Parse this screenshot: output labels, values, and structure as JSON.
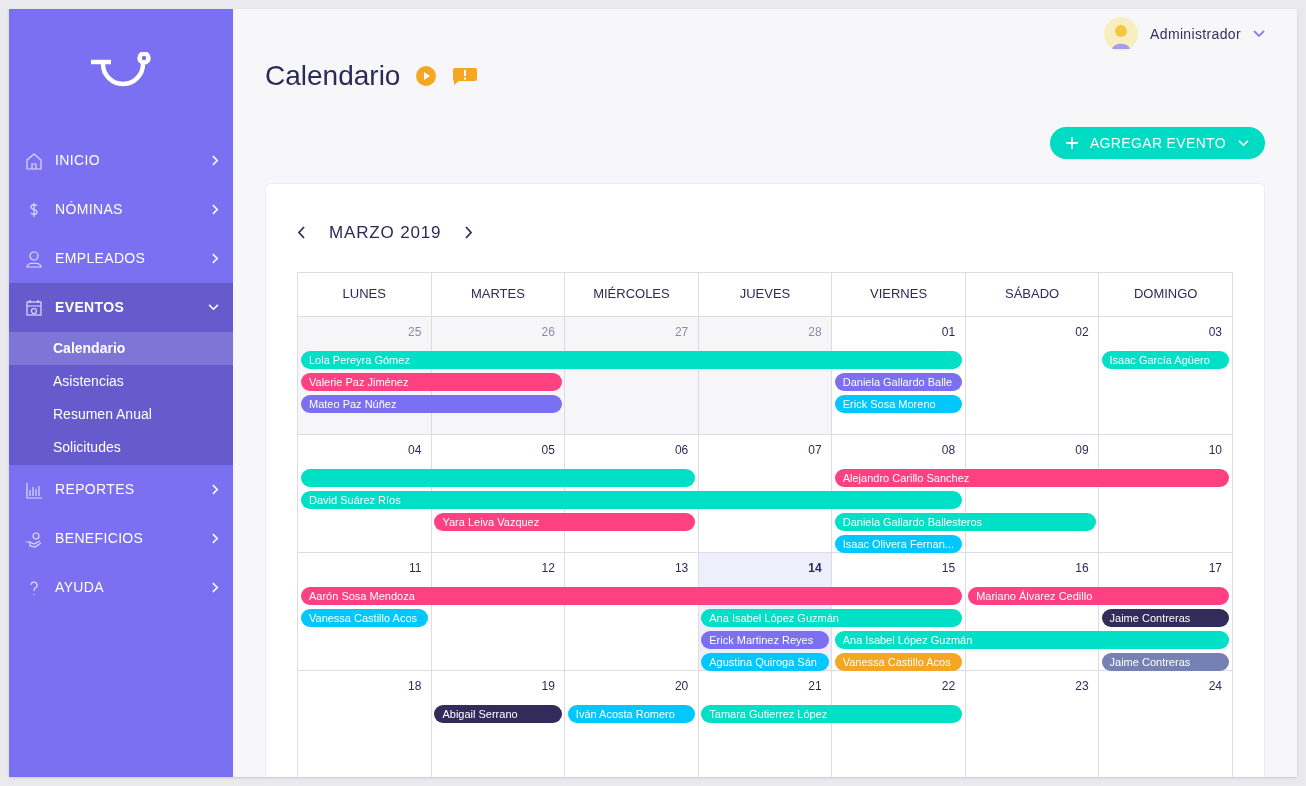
{
  "sidebar": {
    "items": [
      {
        "label": "INICIO",
        "expanded": false
      },
      {
        "label": "NÓMINAS",
        "expanded": false
      },
      {
        "label": "EMPLEADOS",
        "expanded": false
      },
      {
        "label": "EVENTOS",
        "expanded": true,
        "children": [
          {
            "label": "Calendario",
            "selected": true
          },
          {
            "label": "Asistencias",
            "selected": false
          },
          {
            "label": "Resumen Anual",
            "selected": false
          },
          {
            "label": "Solicitudes",
            "selected": false
          }
        ]
      },
      {
        "label": "REPORTES",
        "expanded": false
      },
      {
        "label": "BENEFICIOS",
        "expanded": false
      },
      {
        "label": "AYUDA",
        "expanded": false
      }
    ]
  },
  "user": {
    "name": "Administrador"
  },
  "page": {
    "title": "Calendario"
  },
  "add_button": {
    "label": "AGREGAR EVENTO"
  },
  "calendar": {
    "month": "MARZO 2019",
    "weekdays": [
      "LUNES",
      "MARTES",
      "MIÉRCOLES",
      "JUEVES",
      "VIERNES",
      "SÁBADO",
      "DOMINGO"
    ],
    "weeks": [
      {
        "days": [
          {
            "label": "25",
            "outside_month": true,
            "today": false
          },
          {
            "label": "26",
            "outside_month": true,
            "today": false
          },
          {
            "label": "27",
            "outside_month": true,
            "today": false
          },
          {
            "label": "28",
            "outside_month": true,
            "today": false
          },
          {
            "label": "01",
            "outside_month": false,
            "today": false
          },
          {
            "label": "02",
            "outside_month": false,
            "today": false
          },
          {
            "label": "03",
            "outside_month": false,
            "today": false
          }
        ],
        "lanes": [
          [
            {
              "kind": "event",
              "label": "Lola Pereyra Gómez",
              "color": "#00e0c6"
            },
            {
              "kind": "continuation"
            },
            {
              "kind": "continuation"
            },
            {
              "kind": "continuation"
            },
            {
              "kind": "continuation"
            },
            {
              "kind": "blank"
            },
            {
              "kind": "event",
              "label": "Isaac García Agüero",
              "color": "#00e0c6"
            }
          ],
          [
            {
              "kind": "event",
              "label": "Valerie Paz Jiménez",
              "color": "#ff4081"
            },
            {
              "kind": "continuation"
            },
            {
              "kind": "blank"
            },
            {
              "kind": "blank"
            },
            {
              "kind": "event",
              "label": "Daniela Gallardo Balle",
              "color": "#7b6ff2"
            }
          ],
          [
            {
              "kind": "event",
              "label": "Mateo Paz Núñez",
              "color": "#7b6ff2"
            },
            {
              "kind": "continuation"
            },
            {
              "kind": "blank"
            },
            {
              "kind": "blank"
            },
            {
              "kind": "event",
              "label": "Erick Sosa Moreno",
              "color": "#00c8ff"
            }
          ]
        ]
      },
      {
        "days": [
          {
            "label": "04",
            "outside_month": false,
            "today": false
          },
          {
            "label": "05",
            "outside_month": false,
            "today": false
          },
          {
            "label": "06",
            "outside_month": false,
            "today": false
          },
          {
            "label": "07",
            "outside_month": false,
            "today": false
          },
          {
            "label": "08",
            "outside_month": false,
            "today": false
          },
          {
            "label": "09",
            "outside_month": false,
            "today": false
          },
          {
            "label": "10",
            "outside_month": false,
            "today": false
          }
        ],
        "lanes": [
          [
            {
              "kind": "event",
              "color": "#00e0c6"
            },
            {
              "kind": "continuation"
            },
            {
              "kind": "continuation"
            },
            {
              "kind": "blank"
            },
            {
              "kind": "event",
              "label": "Alejandro Carillo Sanchez",
              "color": "#ff4081"
            },
            {
              "kind": "continuation"
            },
            {
              "kind": "continuation"
            }
          ],
          [
            {
              "kind": "event",
              "label": "David Suárez Ríos",
              "color": "#00e0c6"
            },
            {
              "kind": "continuation"
            },
            {
              "kind": "continuation"
            },
            {
              "kind": "continuation"
            },
            {
              "kind": "continuation"
            }
          ],
          [
            {
              "kind": "blank"
            },
            {
              "kind": "event",
              "label": "Yara Leiva Vazquez",
              "color": "#ff4081"
            },
            {
              "kind": "continuation"
            },
            {
              "kind": "blank"
            },
            {
              "kind": "event",
              "label": "Daniela Gallardo Ballesteros",
              "color": "#00e0c6"
            },
            {
              "kind": "continuation"
            }
          ],
          [
            {
              "kind": "blank"
            },
            {
              "kind": "blank"
            },
            {
              "kind": "blank"
            },
            {
              "kind": "blank"
            },
            {
              "kind": "event",
              "label": "Isaac Olivera Fernan...",
              "color": "#00c8ff"
            }
          ]
        ]
      },
      {
        "days": [
          {
            "label": "11",
            "outside_month": false,
            "today": false
          },
          {
            "label": "12",
            "outside_month": false,
            "today": false
          },
          {
            "label": "13",
            "outside_month": false,
            "today": false
          },
          {
            "label": "14",
            "outside_month": false,
            "today": true
          },
          {
            "label": "15",
            "outside_month": false,
            "today": false
          },
          {
            "label": "16",
            "outside_month": false,
            "today": false
          },
          {
            "label": "17",
            "outside_month": false,
            "today": false
          }
        ],
        "lanes": [
          [
            {
              "kind": "event",
              "label": "Aarón Sosa Mendoza",
              "color": "#ff4081"
            },
            {
              "kind": "continuation"
            },
            {
              "kind": "continuation"
            },
            {
              "kind": "continuation"
            },
            {
              "kind": "continuation"
            },
            {
              "kind": "event",
              "label": "Mariano Álvarez Cedillo",
              "color": "#ff4081"
            },
            {
              "kind": "continuation"
            }
          ],
          [
            {
              "kind": "event",
              "label": "Vanessa Castillo Acos",
              "color": "#00c8ff"
            },
            {
              "kind": "blank"
            },
            {
              "kind": "blank"
            },
            {
              "kind": "event",
              "label": "Ana Isabel López Guzmán",
              "color": "#00e0c6"
            },
            {
              "kind": "continuation"
            },
            {
              "kind": "blank"
            },
            {
              "kind": "event",
              "label": "Jaime Contreras",
              "color": "#322b5c"
            }
          ],
          [
            {
              "kind": "blank"
            },
            {
              "kind": "blank"
            },
            {
              "kind": "blank"
            },
            {
              "kind": "event",
              "label": "Erick Martinez Reyes",
              "color": "#7b6ff2"
            },
            {
              "kind": "event",
              "label": "Ana Isabel López Guzmán",
              "color": "#00e0c6"
            },
            {
              "kind": "continuation"
            },
            {
              "kind": "continuation"
            }
          ],
          [
            {
              "kind": "blank"
            },
            {
              "kind": "blank"
            },
            {
              "kind": "blank"
            },
            {
              "kind": "event",
              "label": "Agustina Quiroga Sán",
              "color": "#00c8ff"
            },
            {
              "kind": "event",
              "label": "Vanessa Castillo Acos",
              "color": "#f5a623"
            },
            {
              "kind": "blank"
            },
            {
              "kind": "event",
              "label": "Jaime Contreras",
              "color": "#7681b3"
            }
          ]
        ]
      },
      {
        "days": [
          {
            "label": "18",
            "outside_month": false,
            "today": false
          },
          {
            "label": "19",
            "outside_month": false,
            "today": false
          },
          {
            "label": "20",
            "outside_month": false,
            "today": false
          },
          {
            "label": "21",
            "outside_month": false,
            "today": false
          },
          {
            "label": "22",
            "outside_month": false,
            "today": false
          },
          {
            "label": "23",
            "outside_month": false,
            "today": false
          },
          {
            "label": "24",
            "outside_month": false,
            "today": false
          }
        ],
        "lanes": [
          [
            {
              "kind": "blank"
            },
            {
              "kind": "event",
              "label": "Abigail Serrano",
              "color": "#322b5c"
            },
            {
              "kind": "event",
              "label": "Iván Acosta Romero",
              "color": "#00c8ff"
            },
            {
              "kind": "event",
              "label": "Tamara Gutierrez López",
              "color": "#00e0c6"
            },
            {
              "kind": "continuation"
            }
          ]
        ]
      }
    ]
  }
}
